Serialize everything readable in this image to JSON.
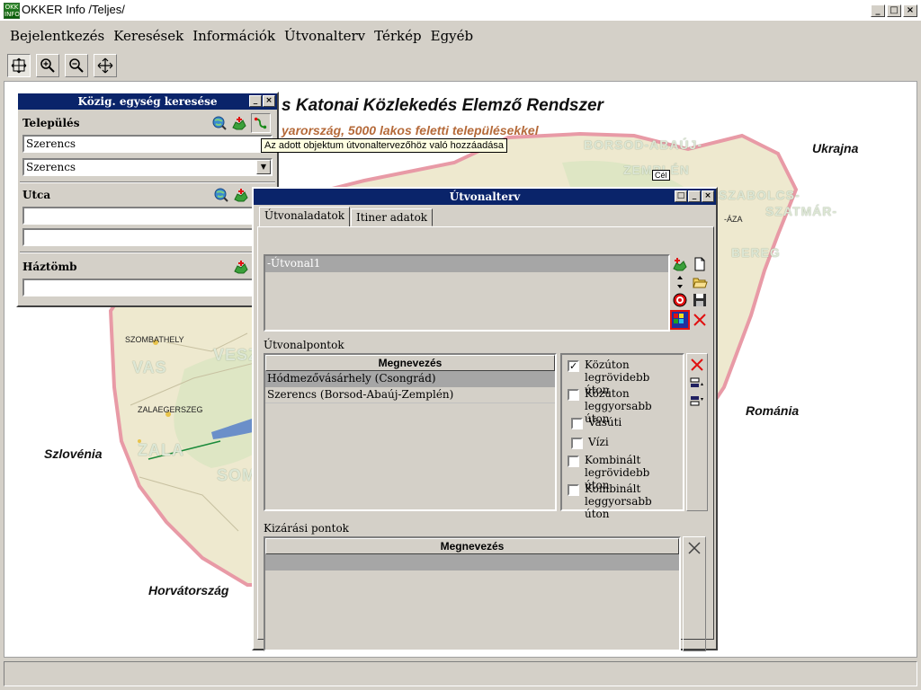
{
  "window": {
    "title": "OKKER Info /Teljes/",
    "icon": "app-logo-icon",
    "icon_text": "OKK INFO"
  },
  "menu": [
    "Bejelentkezés",
    "Keresések",
    "Információk",
    "Útvonalterv",
    "Térkép",
    "Egyéb"
  ],
  "toolbar": [
    "zoom-extent-icon",
    "zoom-in-icon",
    "zoom-out-icon",
    "pan-icon"
  ],
  "map": {
    "title": "s Katonai Közlekedés Elemző Rendszer",
    "subtitle": "yarország, 5000 lakos feletti településekkel",
    "countries": {
      "ukrajna": "Ukrajna",
      "romania": "Románia",
      "szlovenia": "Szlovénia",
      "horvatorszag": "Horvátország"
    },
    "counties": {
      "borsod": "BORSOD-ABAÚJ-",
      "zemplen": "ZEMPLÉN",
      "szabolcs": "SZABOLCS-",
      "szatmar": "SZATMÁR-",
      "bereg": "BEREG",
      "vas": "VAS",
      "veszp": "VESZ",
      "zala": "ZALA",
      "som": "SOM"
    },
    "cities": {
      "szombathely": "SZOMBATHELY",
      "zalaegerszeg": "ZALAEGERSZEG",
      "aza": "-ÁZA"
    },
    "cel_marker": "Cél"
  },
  "kozig_window": {
    "title": "Közig. egység keresése",
    "telepules_label": "Település",
    "telepules_value": "Szerencs",
    "telepules_combo": "Szerencs",
    "utca_label": "Utca",
    "utca_value": "",
    "utca_value2": "",
    "haztomb_label": "Háztömb",
    "haztomb_value": "",
    "tooltip": "Az adott objektum útvonaltervezőhöz való hozzáadása"
  },
  "route_window": {
    "title": "Útvonalterv",
    "tabs": [
      "Útvonaladatok",
      "Itiner adatok"
    ],
    "routes": [
      "-Útvonal1"
    ],
    "points_label": "Útvonalpontok",
    "points_header": "Megnevezés",
    "points": [
      "Hódmezővásárhely (Csongrád)",
      "Szerencs (Borsod-Abaúj-Zemplén)"
    ],
    "options": [
      {
        "label": "Közúton legrövidebb úton",
        "checked": true
      },
      {
        "label": "Közúton leggyorsabb úton",
        "checked": false
      },
      {
        "label": "Vasúti",
        "checked": false
      },
      {
        "label": "Vízi",
        "checked": false
      },
      {
        "label": "Kombinált legrövidebb úton",
        "checked": false
      },
      {
        "label": "Kombinált leggyorsabb úton",
        "checked": false
      }
    ],
    "checked_mark": "✓",
    "exclude_label": "Kizárási pontok",
    "exclude_header": "Megnevezés",
    "exclude_rows": [
      ""
    ]
  },
  "colors": {
    "title_blue": "#0a246a",
    "map_bg": "#f0ecd8",
    "border_pink": "#e89aa6",
    "highlight_red": "#e01010"
  }
}
